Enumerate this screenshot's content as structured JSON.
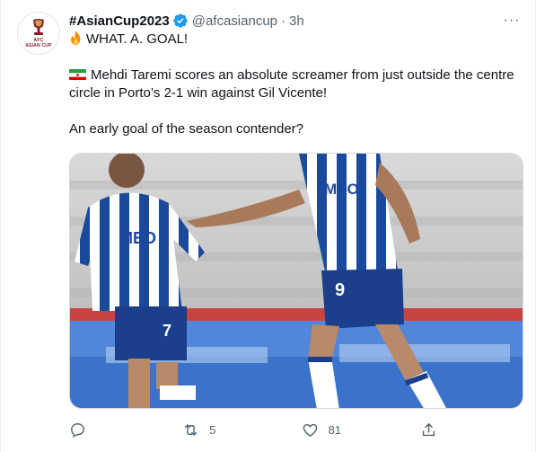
{
  "tweet": {
    "display_name": "#AsianCup2023",
    "handle": "@afcasiancup",
    "separator": "·",
    "time": "3h",
    "more_label": "···",
    "line1": "WHAT. A. GOAL!",
    "line2_a": "Mehdi Taremi scores an absolute screamer from just outside the centre",
    "line2_b": "circle in Porto’s 2-1 win against Gil Vicente!",
    "line3": "An early goal of the season contender?",
    "avatar_text_1": "AFC",
    "avatar_text_2": "ASIAN CUP",
    "media": {
      "shirt_text": "MEO",
      "player_left_number": "7",
      "player_right_number": "9"
    },
    "actions": {
      "reply_count": "",
      "retweet_count": "5",
      "like_count": "81",
      "share_count": ""
    },
    "colors": {
      "verified": "#1d9bf0",
      "text_secondary": "#536471",
      "porto_blue": "#1b4a9c"
    },
    "icons": [
      "fire-icon",
      "iran-flag-icon",
      "verified-badge-icon",
      "more-icon",
      "reply-icon",
      "retweet-icon",
      "like-icon",
      "share-icon"
    ]
  }
}
